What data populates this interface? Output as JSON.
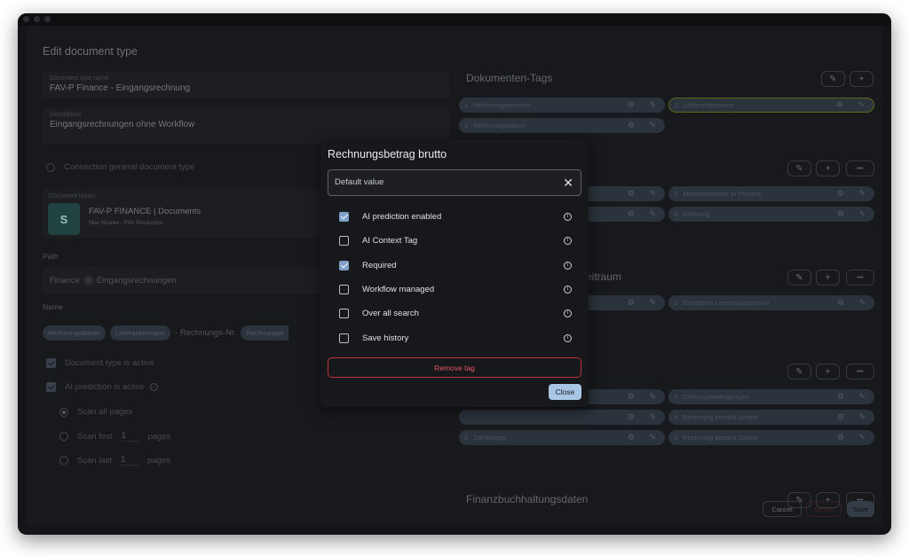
{
  "window": {
    "title": "Edit document type"
  },
  "left": {
    "type_name": {
      "label": "Document type name",
      "value": "FAV-P Finance - Eingangsrechnung"
    },
    "description": {
      "label": "Description",
      "value": "Eingangsrechnungen ohne Workflow"
    },
    "connection_label": "Connection general document type",
    "library": {
      "label": "Document library",
      "name": "FAV-P FINANCE | Documents",
      "sub": "Max Muster - FAV Production",
      "icon_letter": "S"
    },
    "path_label": "Path",
    "path": [
      "Finance",
      "Eingangsrechnungen"
    ],
    "name_label": "Name",
    "name_parts": {
      "chip1": "Rechnungsdatum",
      "chip2": "Lieferantenname",
      "text": "- Rechnungs-Nr.",
      "chip3": "Rechnungsn"
    },
    "active_label": "Document type is active",
    "ai_active_label": "AI prediction is active",
    "scan_all": "Scan all pages",
    "scan_first": "Scan first",
    "scan_last": "Scan last",
    "first_count": "1",
    "last_count": "1",
    "pages": "pages"
  },
  "right": {
    "section1": "Dokumenten-Tags",
    "section2_tail": "eitraum",
    "section3": "Finanzbuchhaltungsdaten",
    "tags": {
      "t1": {
        "num": "1",
        "label": "Rechnungsnummer"
      },
      "t2": {
        "num": "2",
        "label": "Lieferantenname"
      },
      "t3": {
        "num": "3",
        "label": "Rechnungsdatum"
      },
      "g2t2": {
        "num": "2",
        "label": "Mehrwertsteuer in Prozent"
      },
      "g2t4": {
        "num": "4",
        "label": "Währung"
      },
      "g3t2": {
        "num": "2",
        "label": "Enddatum Leistungszeitraum"
      },
      "g4t2": {
        "num": "2",
        "label": "Zahlungsbedingungen"
      },
      "g4t4": {
        "num": "4",
        "label": "Rechnung bezahlt ja/nein"
      },
      "g4t5": {
        "num": "5",
        "label": "Zahlbetrag"
      },
      "g4t6": {
        "num": "6",
        "label": "Rechnung bezahlt Datum"
      }
    },
    "btn_more": "•••",
    "btn_plus": "+"
  },
  "footer": {
    "cancel": "Cancel",
    "delete": "Delete",
    "save": "Save"
  },
  "modal": {
    "title": "Rechnungsbetrag brutto",
    "default_placeholder": "Default value",
    "options": [
      {
        "label": "AI prediction enabled",
        "checked": true
      },
      {
        "label": "AI Context Tag",
        "checked": false
      },
      {
        "label": "Required",
        "checked": true
      },
      {
        "label": "Workflow managed",
        "checked": false
      },
      {
        "label": "Over all search",
        "checked": false
      },
      {
        "label": "Save history",
        "checked": false
      }
    ],
    "remove": "Remove tag",
    "close": "Close"
  },
  "icons": {
    "info": "info-icon",
    "close": "close-icon",
    "gear": "gear-icon",
    "pencil": "pencil-icon",
    "chevron": "chevron-right-icon"
  },
  "colors": {
    "accent": "#a8c6e6",
    "danger": "#c0323b",
    "checkbox": "#7ea0c9"
  }
}
